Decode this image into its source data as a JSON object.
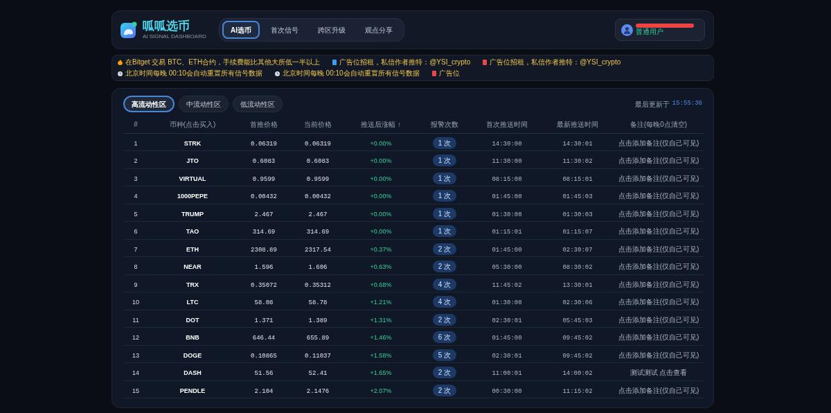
{
  "header": {
    "brand": {
      "title": "呱呱选币",
      "subtitle": "AI SIGNAL DASHBOARD"
    },
    "nav": [
      {
        "label": "AI选币",
        "selected": true
      },
      {
        "label": "首次信号",
        "selected": false
      },
      {
        "label": "跨区升级",
        "selected": false
      },
      {
        "label": "观点分享",
        "selected": false
      }
    ],
    "user": {
      "role": "普通用户",
      "name_redacted": true
    }
  },
  "ticker": [
    {
      "kind": "fire",
      "text": "在Bitget 交易 BTC、ETH合约，手续费能比其他大所低一半以上"
    },
    {
      "kind": "blue-book",
      "text": "广告位招租，私信作者推特：@YSI_crypto"
    },
    {
      "kind": "red-book",
      "text": "广告位招租，私信作者推特：@YSI_crypto"
    },
    {
      "kind": "clock",
      "text": "北京时间每晚 00:10会自动重置所有信号数据"
    },
    {
      "kind": "clock",
      "text": "北京时间每晚 00:10会自动重置所有信号数据"
    },
    {
      "kind": "red-book",
      "text": "广告位"
    }
  ],
  "zones": [
    {
      "label": "高流动性区",
      "selected": true
    },
    {
      "label": "中流动性区",
      "selected": false
    },
    {
      "label": "低流动性区",
      "selected": false
    }
  ],
  "last_updated": {
    "label": "最后更新于",
    "time": "15:55:38"
  },
  "table": {
    "columns": [
      "#",
      "币种(点击买入)",
      "首推价格",
      "当前价格",
      "推送后涨幅 ↑",
      "报警次数",
      "首次推送时间",
      "最新推送时间",
      "备注(每晚0点清空)"
    ],
    "rows": [
      [
        "1",
        "STRK",
        "0.06319",
        "0.06319",
        "+0.00%",
        "1 次",
        "14:30:00",
        "14:30:01",
        "点击添加备注(仅自己可见)"
      ],
      [
        "2",
        "JTO",
        "0.6083",
        "0.6083",
        "+0.00%",
        "1 次",
        "11:30:00",
        "11:30:02",
        "点击添加备注(仅自己可见)"
      ],
      [
        "3",
        "VIRTUAL",
        "0.9599",
        "0.9599",
        "+0.00%",
        "1 次",
        "08:15:00",
        "08:15:01",
        "点击添加备注(仅自己可见)"
      ],
      [
        "4",
        "1000PEPE",
        "0.00432",
        "0.00432",
        "+0.00%",
        "1 次",
        "01:45:00",
        "01:45:03",
        "点击添加备注(仅自己可见)"
      ],
      [
        "5",
        "TRUMP",
        "2.467",
        "2.467",
        "+0.00%",
        "1 次",
        "01:30:00",
        "01:30:03",
        "点击添加备注(仅自己可见)"
      ],
      [
        "6",
        "TAO",
        "314.69",
        "314.69",
        "+0.00%",
        "1 次",
        "01:15:01",
        "01:15:07",
        "点击添加备注(仅自己可见)"
      ],
      [
        "7",
        "ETH",
        "2308.89",
        "2317.54",
        "+0.37%",
        "2 次",
        "01:45:00",
        "02:30:07",
        "点击添加备注(仅自己可见)"
      ],
      [
        "8",
        "NEAR",
        "1.596",
        "1.606",
        "+0.63%",
        "2 次",
        "05:30:00",
        "08:30:02",
        "点击添加备注(仅自己可见)"
      ],
      [
        "9",
        "TRX",
        "0.35072",
        "0.35312",
        "+0.68%",
        "4 次",
        "11:45:02",
        "13:30:01",
        "点击添加备注(仅自己可见)"
      ],
      [
        "10",
        "LTC",
        "58.08",
        "58.78",
        "+1.21%",
        "4 次",
        "01:30:00",
        "02:30:06",
        "点击添加备注(仅自己可见)"
      ],
      [
        "11",
        "DOT",
        "1.371",
        "1.389",
        "+1.31%",
        "2 次",
        "02:30:01",
        "05:45:03",
        "点击添加备注(仅自己可见)"
      ],
      [
        "12",
        "BNB",
        "646.44",
        "655.89",
        "+1.46%",
        "6 次",
        "01:45:00",
        "09:45:02",
        "点击添加备注(仅自己可见)"
      ],
      [
        "13",
        "DOGE",
        "0.10865",
        "0.11037",
        "+1.58%",
        "5 次",
        "02:30:01",
        "09:45:02",
        "点击添加备注(仅自己可见)"
      ],
      [
        "14",
        "DASH",
        "51.56",
        "52.41",
        "+1.65%",
        "2 次",
        "11:00:01",
        "14:00:02",
        "测试测试 点击查看"
      ],
      [
        "15",
        "PENDLE",
        "2.104",
        "2.1476",
        "+2.07%",
        "2 次",
        "00:30:00",
        "11:15:02",
        "点击添加备注(仅自己可见)"
      ]
    ]
  }
}
